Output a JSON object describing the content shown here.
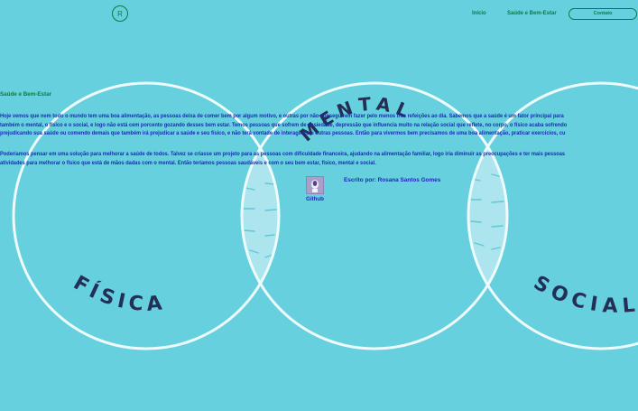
{
  "colors": {
    "background": "#66d0df",
    "accent_green": "#0f7a3f",
    "text_blue": "#1c2ab5",
    "circle_stroke": "#eefbfd",
    "overlap_fill": "#b8e9f1",
    "arc_text": "#232f55"
  },
  "header": {
    "logo_letter": "R",
    "nav": [
      "Início",
      "Saúde e Bem-Estar"
    ],
    "contact_label": "Contato"
  },
  "article": {
    "title": "Saúde e Bem-Estar",
    "paragraph1": "Hoje vemos que nem todo o mundo tem uma boa alimentação, as pessoas deixa de comer bem por algum motivo, e outras por não conseguirem fazer pelo menos três refeições ao dia. Sabemos que a saúde é um fator principal para\ntambém o mental, o físico e o social, e logo não está cem porcento gozando desses bem estar. Temos pessoas que sofrem de ansiedade, depressão que influencia muito na relação social que reflete, no corpo, o físico acaba sofrendo\nprejudicando sua saúde ou comendo demais que também irá prejudicar a saúde e seu físico, e não terá vontade de interagir com outras pessoas. Então para vivermos bem precisamos de uma boa alimentação, praticar exercícios, cu",
    "paragraph2": "Poderíamos pensar em uma solução para melhorar a saúde de todos. Talvez se criasse um projeto para as pessoas com dificuldade financeira, ajudando na alimentação familiar, logo iria diminuir as preocupações e ter mais pessoas\natividades para melhorar o físico que está de mãos dadas com o mental. Então teríamos pessoas saudáveis e com o seu bem estar, físico, mental e social.",
    "github_label": "Github",
    "author": "Escrito por: Rosana Santos Gomes"
  },
  "diagram": {
    "labels": [
      "FÍSICA",
      "MENTAL",
      "SOCIAL"
    ]
  }
}
